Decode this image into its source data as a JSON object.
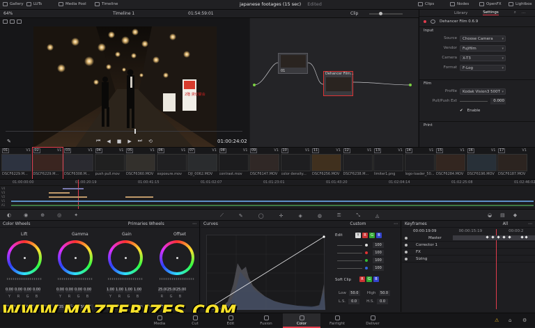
{
  "topbar": {
    "left_items": [
      "Gallery",
      "LUTs",
      "Media Pool",
      "Timeline"
    ],
    "project_title": "japanese footages (15 sec)",
    "project_status": "Edited",
    "right_items": [
      "Clips",
      "Nodes",
      "OpenFX",
      "Lightbox"
    ]
  },
  "viewer": {
    "zoom": "64%",
    "timeline_name": "Timeline 1",
    "timecode_top": "01:54:59:01",
    "timecode_bottom": "01:00:24:02",
    "sign_text": "2階 貸切宴会"
  },
  "nodes": {
    "mode_label": "Clip",
    "node1_label": "01",
    "node2_label": "Dehancer Film..."
  },
  "right_panel": {
    "tabs": [
      "Library",
      "Settings"
    ],
    "plugin_title": "Dehancer Film 0.6.9",
    "input_section": "Input",
    "props": [
      {
        "label": "Source",
        "value": "Choose Camera"
      },
      {
        "label": "Vendor",
        "value": "Fujifilm"
      },
      {
        "label": "Camera",
        "value": "X-T3"
      },
      {
        "label": "Format",
        "value": "F-Log"
      }
    ],
    "film_section": "Film",
    "profile_label": "Profile",
    "profile_value": "Kodak Vision3 500T",
    "pushpull_label": "Pull/Push Ext",
    "pushpull_value": "0.000",
    "enable_label": "Enable",
    "print_section": "Print"
  },
  "clips": [
    {
      "num": "01",
      "track": "V1",
      "name": "DSCF6229.M..."
    },
    {
      "num": "02",
      "track": "V1",
      "name": "DSCF6229.M..."
    },
    {
      "num": "03",
      "track": "V1",
      "name": "DSCF6308.M..."
    },
    {
      "num": "04",
      "track": "V1",
      "name": "push pull.mov"
    },
    {
      "num": "05",
      "track": "V1",
      "name": "DSCF6360.MOV"
    },
    {
      "num": "06",
      "track": "V1",
      "name": "exposure.mov"
    },
    {
      "num": "07",
      "track": "V1",
      "name": "DJI_0062.MOV"
    },
    {
      "num": "08",
      "track": "V1",
      "name": "contrast.mov"
    },
    {
      "num": "09",
      "track": "V1",
      "name": "DSCF6147.MOV"
    },
    {
      "num": "10",
      "track": "V1",
      "name": "color density..."
    },
    {
      "num": "11",
      "track": "V1",
      "name": "DSCF6256.MOV"
    },
    {
      "num": "12",
      "track": "V1",
      "name": "DSCF6238.M..."
    },
    {
      "num": "13",
      "track": "V1",
      "name": "limiter1.png"
    },
    {
      "num": "14",
      "track": "V1",
      "name": "logo-loader_50..."
    },
    {
      "num": "15",
      "track": "V1",
      "name": "DSCF6284.MOV"
    },
    {
      "num": "16",
      "track": "V1",
      "name": "DSCF6196.MOV"
    },
    {
      "num": "17",
      "track": "V1",
      "name": "DSCF6187.MOV"
    }
  ],
  "timeline": {
    "ruler": [
      "01:00:00:00",
      "01:00:20:19",
      "01:00:41:15",
      "01:01:02:07",
      "01:01:23:01",
      "01:01:43:20",
      "01:02:04:14",
      "01:02:25:08",
      "01:02:46:02"
    ],
    "tracks": [
      "V4",
      "V3",
      "V2",
      "V1",
      "A1"
    ]
  },
  "color_wheels": {
    "title": "Color Wheels",
    "mode": "Primaries Wheels",
    "wheels": [
      {
        "name": "Lift",
        "values": [
          "0.00",
          "0.00",
          "0.00",
          "0.00"
        ],
        "channels": [
          "Y",
          "R",
          "G",
          "B"
        ]
      },
      {
        "name": "Gamma",
        "values": [
          "0.00",
          "0.00",
          "0.00",
          "0.00"
        ],
        "channels": [
          "Y",
          "R",
          "G",
          "B"
        ]
      },
      {
        "name": "Gain",
        "values": [
          "1.00",
          "1.00",
          "1.00",
          "1.00"
        ],
        "channels": [
          "Y",
          "R",
          "G",
          "B"
        ]
      },
      {
        "name": "Offset",
        "values": [
          "25.00",
          "25.00",
          "25.00"
        ],
        "channels": [
          "R",
          "G",
          "B"
        ]
      }
    ],
    "bottom": [
      {
        "label": "Contrast",
        "value": "1.000"
      },
      {
        "label": "Pivot",
        "value": "0.435"
      },
      {
        "label": "Sat",
        "value": "50.00"
      },
      {
        "label": "Hue",
        "value": "50.00"
      },
      {
        "label": "Lum Mix",
        "value": "100.00"
      }
    ]
  },
  "curves": {
    "title": "Curves",
    "mode": "Custom",
    "edit_label": "Edit",
    "channel_values": [
      "100",
      "100",
      "100",
      "100"
    ],
    "soft_clip_label": "Soft Clip",
    "low_label": "Low",
    "low_value": "50.0",
    "high_label": "High",
    "high_value": "50.0",
    "ls_label": "L.S.",
    "ls_value": "0.0",
    "hs_label": "H.S.",
    "hs_value": "0.0"
  },
  "keyframes": {
    "title": "Keyframes",
    "filter": "All",
    "timecode_left": "00:00:19:09",
    "timecode_right": "00:00:15:19",
    "timecode_far": "00:00:2",
    "rows": [
      "Master",
      "Corrector 1",
      "FX",
      "Sizing"
    ]
  },
  "pages": [
    "Media",
    "Cut",
    "Edit",
    "Fusion",
    "Color",
    "Fairlight",
    "Deliver"
  ],
  "active_page": "Color",
  "watermark": "WWW.MAZTERIZES.COM",
  "colors": {
    "accent": "#e33d4d",
    "background": "#1b1b1d",
    "watermark": "#f7e22a"
  }
}
